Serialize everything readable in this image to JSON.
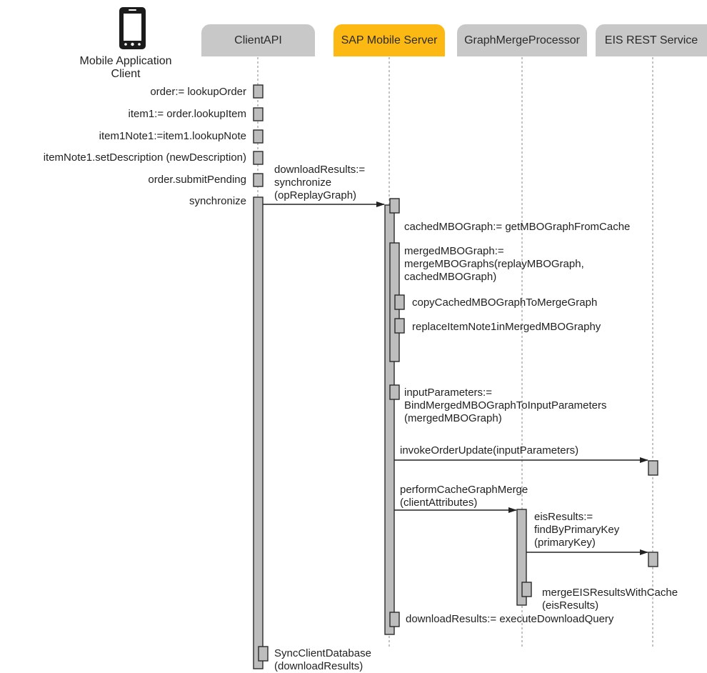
{
  "actors": {
    "mobile_client": "Mobile Application\nClient",
    "client_api": "ClientAPI",
    "sap_mobile_server": "SAP Mobile Server",
    "graph_merge_processor": "GraphMergeProcessor",
    "eis_rest_service": "EIS REST Service"
  },
  "colors": {
    "header_gray": "#c8c8c8",
    "header_highlight": "#fdb913",
    "activation_fill": "#bdbdbd",
    "line": "#222222"
  },
  "client_calls": [
    "order:= lookupOrder",
    "item1:= order.lookupItem",
    "item1Note1:=item1.lookupNote",
    "itemNote1.setDescription (newDescription)",
    "order.submitPending",
    "synchronize"
  ],
  "messages": {
    "download_results": "downloadResults:=\nsynchronize\n(opReplayGraph)",
    "cached_graph": "cachedMBOGraph:= getMBOGraphFromCache",
    "merged_graph": "mergedMBOGraph:=\nmergeMBOGraphs(replayMBOGraph,\ncachedMBOGraph)",
    "copy_cached": "copyCachedMBOGraphToMergeGraph",
    "replace_note": "replaceItemNote1inMergedMBOGraphy",
    "input_params": "inputParameters:=\nBindMergedMBOGraphToInputParameters\n(mergedMBOGraph)",
    "invoke_update": "invokeOrderUpdate(inputParameters)",
    "perform_merge": "performCacheGraphMerge\n(clientAttributes)",
    "eis_results": "eisResults:=\nfindByPrimaryKey\n(primaryKey)",
    "merge_eis": "mergeEISResultsWithCache\n(eisResults)",
    "execute_download": "downloadResults:= executeDownloadQuery",
    "sync_db": "SyncClientDatabase\n(downloadResults)"
  }
}
